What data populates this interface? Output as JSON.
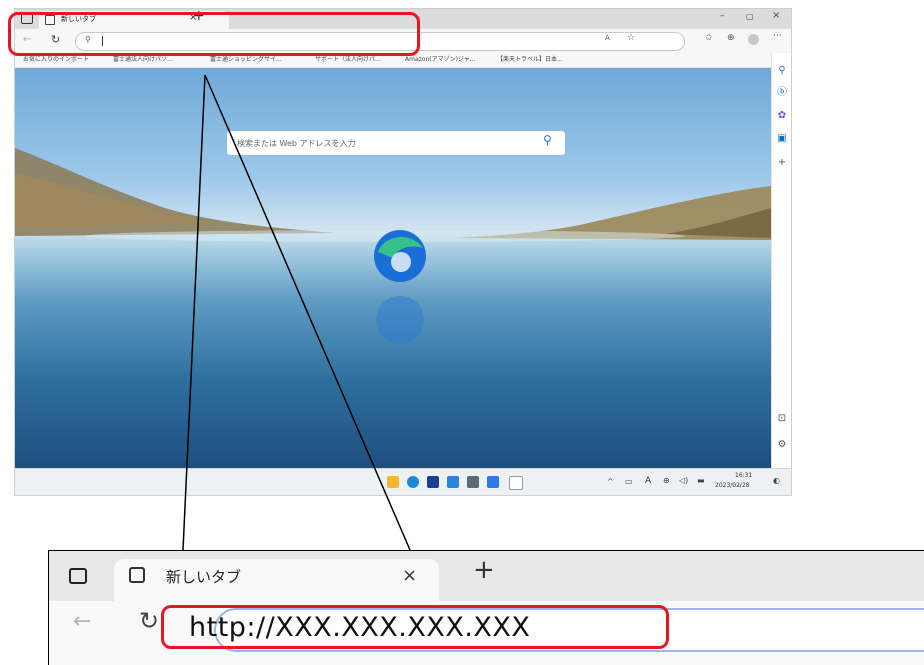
{
  "browser": {
    "tab_title": "新しいタブ",
    "search_placeholder": "検索または Web アドレスを入力",
    "bookmarks": [
      "お気に入りのインポート",
      "富士通法人向けパソ...",
      "富士通ショッピングサイ...",
      "サポート（法人向けパ...",
      "Amazon(アマゾン)ジャ...",
      "【楽天トラベル】日本..."
    ]
  },
  "taskbar": {
    "time": "16:31",
    "date": "2023/02/28",
    "ime": "A"
  },
  "zoom": {
    "tab_title": "新しいタブ",
    "url": "http://XXX.XXX.XXX.XXX"
  },
  "colors": {
    "highlight": "#e8171f",
    "edge_blue": "#1a6fd6",
    "edge_green": "#36c08a"
  }
}
